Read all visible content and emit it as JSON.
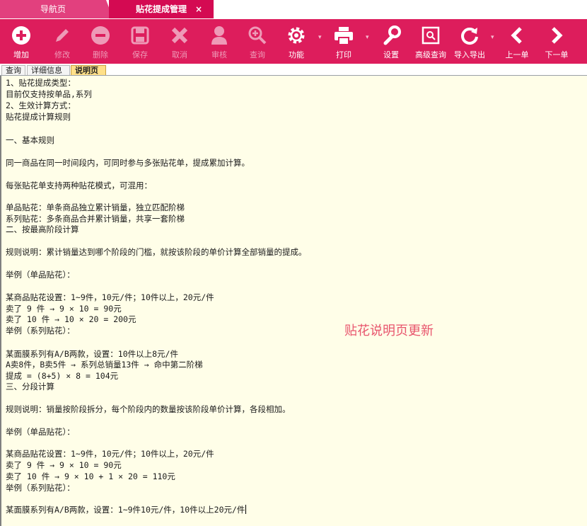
{
  "tabs": [
    {
      "label": "导航页",
      "active": false
    },
    {
      "label": "贴花提成管理",
      "active": true
    }
  ],
  "tab_close_glyph": "×",
  "toolbar": {
    "accent_color": "#dd1d5c",
    "buttons": [
      {
        "id": "add",
        "label": "增加",
        "icon": "plus-circle-icon",
        "enabled": true
      },
      {
        "id": "edit",
        "label": "修改",
        "icon": "pencil-icon",
        "enabled": false
      },
      {
        "id": "delete",
        "label": "删除",
        "icon": "minus-circle-icon",
        "enabled": false
      },
      {
        "id": "save",
        "label": "保存",
        "icon": "floppy-disk-icon",
        "enabled": false
      },
      {
        "id": "cancel",
        "label": "取消",
        "icon": "x-mark-icon",
        "enabled": false
      },
      {
        "id": "audit",
        "label": "审核",
        "icon": "user-icon",
        "enabled": false
      },
      {
        "id": "query",
        "label": "查询",
        "icon": "zoom-in-icon",
        "enabled": false
      },
      {
        "id": "function",
        "label": "功能",
        "icon": "gear-icon",
        "enabled": true
      },
      {
        "id": "print",
        "label": "打印",
        "icon": "printer-icon",
        "enabled": true
      },
      {
        "id": "settings",
        "label": "设置",
        "icon": "wrench-icon",
        "enabled": true
      },
      {
        "id": "advanced_query",
        "label": "高级查询",
        "icon": "image-search-icon",
        "enabled": true
      },
      {
        "id": "import_export",
        "label": "导入导出",
        "icon": "refresh-icon",
        "enabled": true
      },
      {
        "id": "prev",
        "label": "上一单",
        "icon": "chevron-left-icon",
        "enabled": true
      },
      {
        "id": "next",
        "label": "下一单",
        "icon": "chevron-right-icon",
        "enabled": true
      }
    ]
  },
  "subtabs": [
    {
      "label": "查询",
      "active": false
    },
    {
      "label": "详细信息",
      "active": false
    },
    {
      "label": "说明页",
      "active": true
    }
  ],
  "description": {
    "watermark": "贴花说明页更新",
    "lines": [
      "1、贴花提成类型：",
      "目前仅支持按单品,系列",
      "2、生效计算方式：",
      "贴花提成计算规则",
      "",
      "一、基本规则",
      "",
      "同一商品在同一时间段内，可同时参与多张贴花单，提成累加计算。",
      "",
      "每张贴花单支持两种贴花模式，可混用：",
      "",
      "单品贴花：单条商品独立累计销量，独立匹配阶梯",
      "系列贴花：多条商品合并累计销量，共享一套阶梯",
      "二、按最高阶段计算",
      "",
      "规则说明：累计销量达到哪个阶段的门槛，就按该阶段的单价计算全部销量的提成。",
      "",
      "举例（单品贴花）：",
      "",
      "某商品贴花设置：1~9件，10元/件；10件以上，20元/件",
      "卖了 9 件 → 9 × 10 = 90元",
      "卖了 10 件 → 10 × 20 = 200元",
      "举例（系列贴花）：",
      "",
      "某面膜系列有A/B两款，设置：10件以上8元/件",
      "A卖8件，B卖5件 → 系列总销量13件 → 命中第二阶梯",
      "提成 = (8+5) × 8 = 104元",
      "三、分段计算",
      "",
      "规则说明：销量按阶段拆分，每个阶段内的数量按该阶段单价计算，各段相加。",
      "",
      "举例（单品贴花）：",
      "",
      "某商品贴花设置：1~9件，10元/件；10件以上，20元/件",
      "卖了 9 件 → 9 × 10 = 90元",
      "卖了 10 件 → 9 × 10 + 1 × 20 = 110元",
      "举例（系列贴花）：",
      "",
      "某面膜系列有A/B两款，设置：1~9件10元/件，10件以上20元/件"
    ]
  }
}
